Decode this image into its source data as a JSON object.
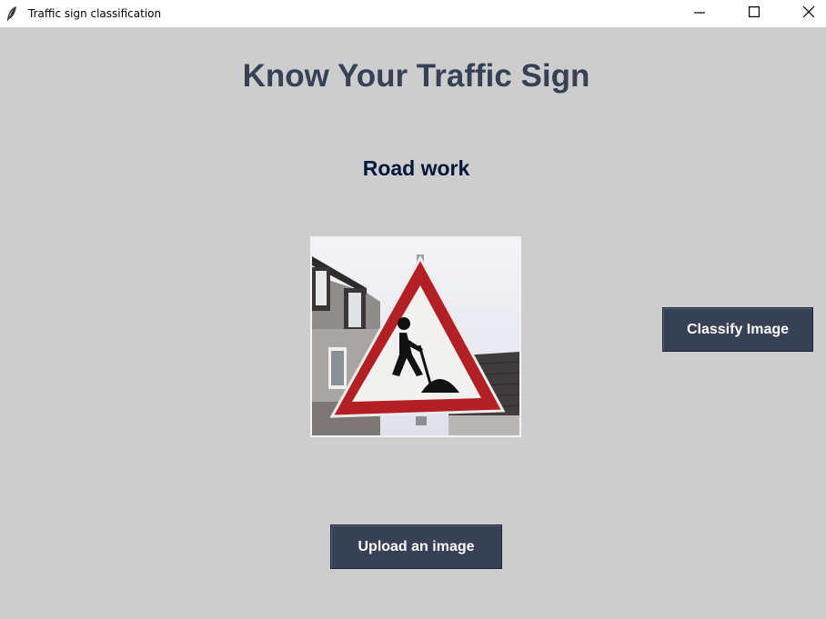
{
  "window": {
    "title": "Traffic sign classification",
    "icon": "feather-icon",
    "controls": [
      "minimize-icon",
      "maximize-icon",
      "close-icon"
    ]
  },
  "main": {
    "heading": "Know Your Traffic Sign",
    "result": "Road work",
    "image": {
      "subject": "road-work-warning-sign"
    },
    "classify_button": "Classify Image",
    "upload_button": "Upload an image"
  },
  "colors": {
    "background": "#cdcdcd",
    "heading": "#364156",
    "result": "#011638",
    "button_bg": "#364156",
    "button_text": "#ffffff"
  }
}
